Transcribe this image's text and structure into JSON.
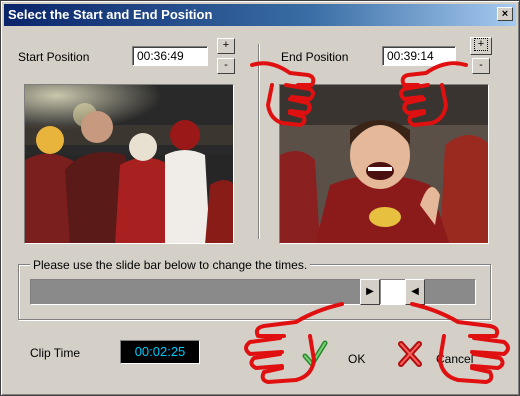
{
  "window": {
    "title": "Select the Start and End Position",
    "close_glyph": "×"
  },
  "start": {
    "label": "Start Position",
    "time": "00:36:49",
    "plus": "+",
    "minus": "-"
  },
  "end": {
    "label": "End Position",
    "time": "00:39:14",
    "plus": "+",
    "minus": "-"
  },
  "slider": {
    "instruction": "Please use the slide bar below to change the times.",
    "left_arrow": "▶",
    "right_arrow": "◀"
  },
  "clip": {
    "label": "Clip Time",
    "time": "00:02:25"
  },
  "buttons": {
    "ok": "OK",
    "cancel": "Cancel"
  },
  "colors": {
    "hand": "#e01010",
    "cliptime_text": "#00c8ff",
    "title_bar": "#0a246a"
  }
}
